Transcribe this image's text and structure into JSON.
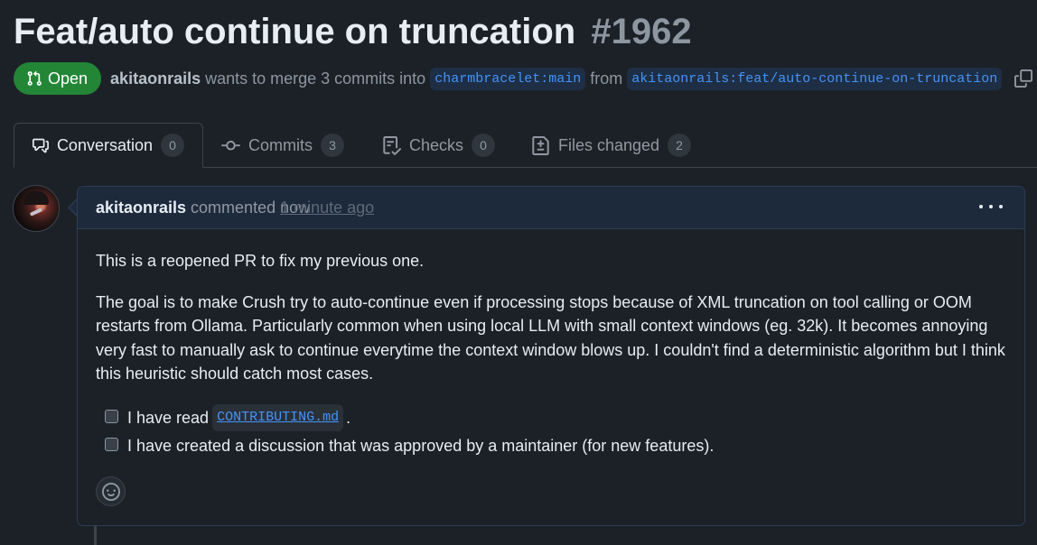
{
  "pr": {
    "title": "Feat/auto continue on truncation",
    "number": "#1962",
    "state": "Open",
    "author": "akitaonrails",
    "merge_text": "wants to merge 3 commits into",
    "base_branch": "charmbracelet:main",
    "from_text": "from",
    "head_branch": "akitaonrails:feat/auto-continue-on-truncation"
  },
  "tabs": [
    {
      "label": "Conversation",
      "count": "0",
      "icon": "comment-discussion-icon"
    },
    {
      "label": "Commits",
      "count": "3",
      "icon": "git-commit-icon"
    },
    {
      "label": "Checks",
      "count": "0",
      "icon": "checklist-icon"
    },
    {
      "label": "Files changed",
      "count": "2",
      "icon": "file-diff-icon"
    }
  ],
  "comment": {
    "author": "akitaonrails",
    "verb": "commented",
    "time_now": "now",
    "time_ago": "1 minute ago",
    "paragraphs": [
      "This is a reopened PR to fix my previous one.",
      "The goal is to make Crush try to auto-continue even if processing stops because of XML truncation on tool calling or OOM restarts from Ollama. Particularly common when using local LLM with small context windows (eg. 32k). It becomes annoying very fast to manually ask to continue everytime the context window blows up. I couldn't find a deterministic algorithm but I think this heuristic should catch most cases."
    ],
    "tasks": [
      {
        "prefix": "I have read",
        "code": "CONTRIBUTING.md",
        "suffix": ".",
        "checked": false
      },
      {
        "prefix": "I have created a discussion that was approved by a maintainer (for new features).",
        "checked": false
      }
    ]
  },
  "colors": {
    "background": "#1c2128",
    "open_green": "#238636",
    "link_blue": "#4493f8",
    "muted": "#9198a1"
  }
}
